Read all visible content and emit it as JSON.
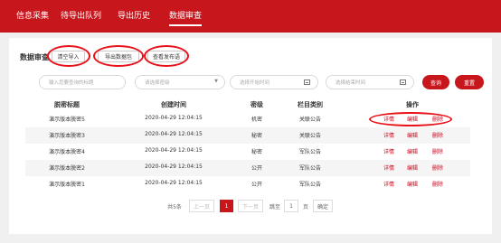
{
  "nav": {
    "items": [
      "信息采集",
      "待导出队列",
      "导出历史",
      "数据审查"
    ],
    "active_index": 3
  },
  "section_title": "数据审查",
  "buttons": {
    "clear_import": "清空导入",
    "export_package": "导出数据包",
    "view_published": "查看发布语"
  },
  "filters": {
    "title_placeholder": "输入您要查询的标题",
    "level_placeholder": "请选择密级",
    "start_placeholder": "选择开始时间",
    "end_placeholder": "选择结束时间",
    "query_label": "查询",
    "reset_label": "重置"
  },
  "table": {
    "headers": [
      "脱密标题",
      "创建时间",
      "密级",
      "栏目类别",
      "操作"
    ],
    "rows": [
      {
        "title": "演示版本脱密5",
        "time": "2020-04-29 12:04:15",
        "level": "机密",
        "category": "关联公告"
      },
      {
        "title": "演示版本脱密3",
        "time": "2020-04-29 12:04:15",
        "level": "秘密",
        "category": "关联公告"
      },
      {
        "title": "演示版本脱密4",
        "time": "2020-04-29 12:04:15",
        "level": "秘密",
        "category": "军队公告"
      },
      {
        "title": "演示版本脱密2",
        "time": "2020-04-29 12:04:15",
        "level": "公开",
        "category": "军队公告"
      },
      {
        "title": "演示版本脱密1",
        "time": "2020-04-29 12:04:15",
        "level": "公开",
        "category": "军队公告"
      }
    ],
    "actions": {
      "detail": "详情",
      "edit": "编辑",
      "delete": "删除"
    }
  },
  "pagination": {
    "total": "共5条",
    "prev": "上一页",
    "current": "1",
    "next": "下一页",
    "goto_prefix": "跳至",
    "goto_value": "1",
    "goto_suffix": "页",
    "confirm": "确定"
  },
  "colors": {
    "brand": "#c8161d",
    "highlight": "#e8121b"
  }
}
